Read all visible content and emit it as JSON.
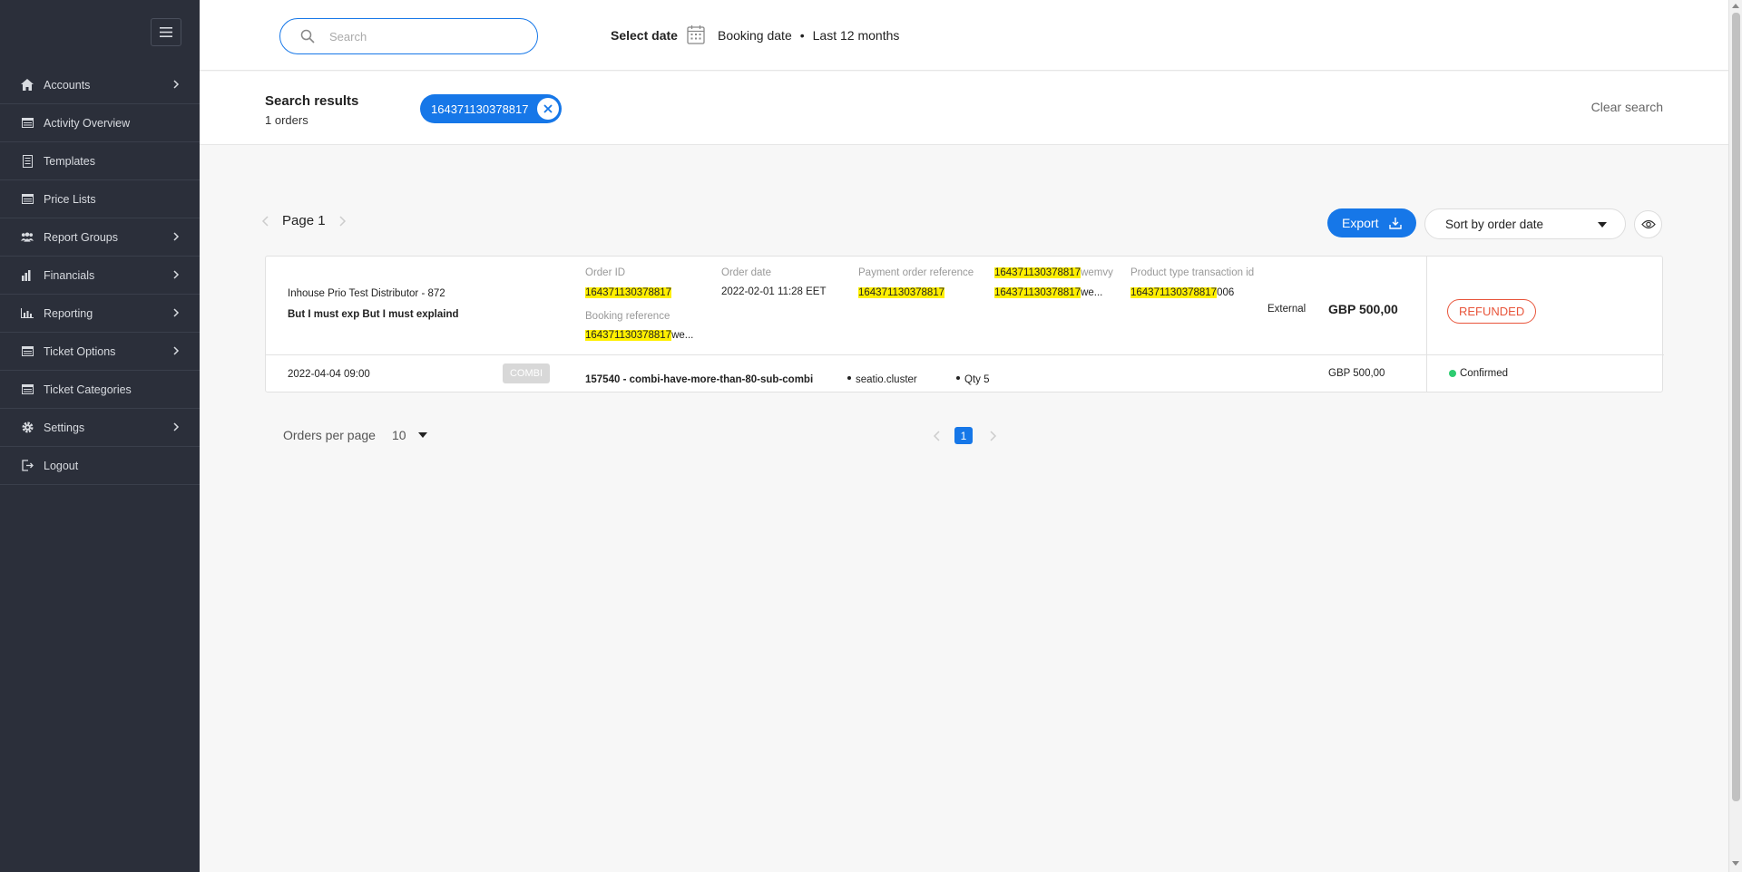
{
  "sidebar": {
    "items": [
      {
        "label": "Accounts",
        "icon": "home-icon",
        "has_arrow": true
      },
      {
        "label": "Activity Overview",
        "icon": "window-icon",
        "has_arrow": false
      },
      {
        "label": "Templates",
        "icon": "document-icon",
        "has_arrow": false
      },
      {
        "label": "Price Lists",
        "icon": "window-icon",
        "has_arrow": false
      },
      {
        "label": "Report Groups",
        "icon": "users-icon",
        "has_arrow": true
      },
      {
        "label": "Financials",
        "icon": "bar-chart-icon",
        "has_arrow": true
      },
      {
        "label": "Reporting",
        "icon": "line-chart-icon",
        "has_arrow": true
      },
      {
        "label": "Ticket Options",
        "icon": "window-icon",
        "has_arrow": true
      },
      {
        "label": "Ticket Categories",
        "icon": "window-icon",
        "has_arrow": false
      },
      {
        "label": "Settings",
        "icon": "gear-icon",
        "has_arrow": true
      },
      {
        "label": "Logout",
        "icon": "logout-icon",
        "has_arrow": false
      }
    ]
  },
  "topbar": {
    "search_placeholder": "Search",
    "select_date_label": "Select date",
    "date_type": "Booking date",
    "date_range": "Last 12 months"
  },
  "results": {
    "title": "Search results",
    "count": "1 orders",
    "chip_value": "164371130378817",
    "clear_label": "Clear search"
  },
  "pager": {
    "page_label": "Page 1",
    "export_label": "Export",
    "sort_label": "Sort by order date"
  },
  "order": {
    "distributor": "Inhouse Prio Test Distributor - 872",
    "description": "But I must exp But I must explaind",
    "order_id_label": "Order ID",
    "order_id": "164371130378817",
    "booking_ref_label": "Booking reference",
    "booking_ref_hl": "164371130378817",
    "booking_ref_rest": "we...",
    "order_date_label": "Order date",
    "order_date": "2022-02-01 11:28 EET",
    "payment_ref_label": "Payment order reference",
    "payment_ref": "164371130378817",
    "extra_ref_1_hl": "164371130378817",
    "extra_ref_1_rest": "wemvy",
    "extra_ref_2_hl": "164371130378817",
    "extra_ref_2_rest": "we...",
    "product_tx_label": "Product type transaction id",
    "product_tx_hl": "164371130378817",
    "product_tx_rest": "006",
    "channel": "External",
    "amount": "GBP 500,00",
    "status": "REFUNDED",
    "status_color": "#e8553b",
    "line": {
      "booking_date": "2022-04-04 09:00",
      "badge": "COMBI",
      "product": "157540 - combi-have-more-than-80-sub-combi",
      "supplier": "seatio.cluster",
      "qty": "Qty 5",
      "price": "GBP 500,00",
      "status": "Confirmed",
      "status_color": "#2ecc71"
    }
  },
  "bottom": {
    "orders_per_page_label": "Orders per page",
    "orders_per_page_value": "10",
    "current_page": "1"
  },
  "colors": {
    "accent": "#1677e8",
    "sidebar_bg": "#2b2f3a",
    "highlight": "#ffef00"
  }
}
